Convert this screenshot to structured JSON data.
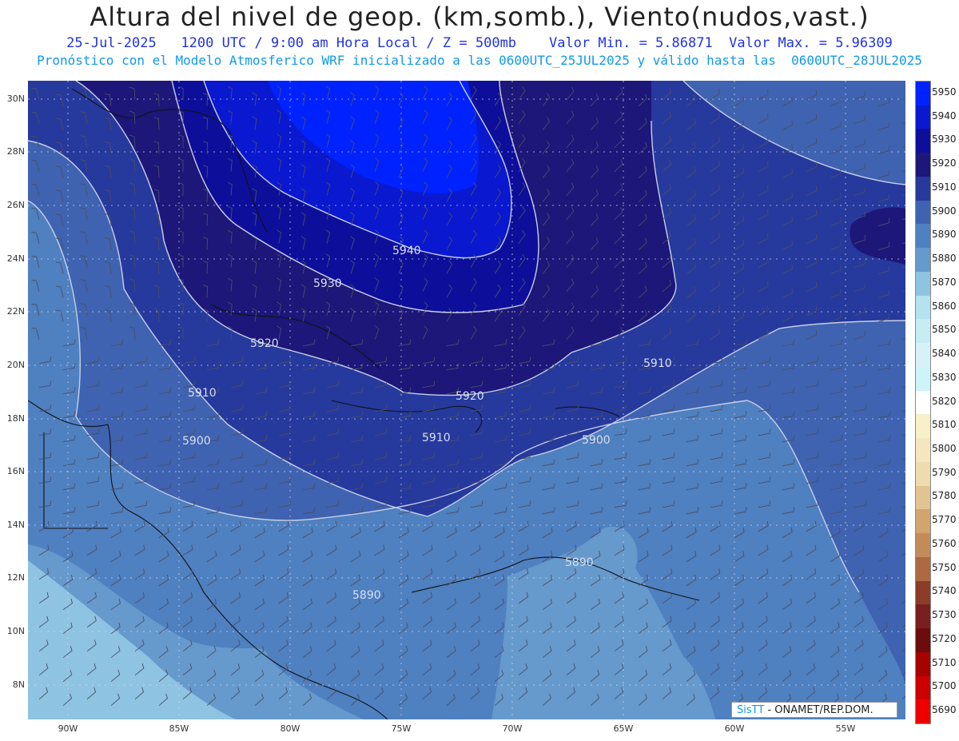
{
  "header": {
    "title": "Altura del nivel de geop. (km,somb.), Viento(nudos,vast.)",
    "line1": "25-Jul-2025   1200 UTC / 9:00 am Hora Local / Z = 500mb    Valor Min. = 5.86871  Valor Max. = 5.96309",
    "line2": "Pronóstico con el Modelo Atmosferico WRF inicializado a las 0600UTC_25JUL2025 y válido hasta las  0600UTC_28JUL2025"
  },
  "axes": {
    "lat_labels": [
      "30N",
      "28N",
      "26N",
      "24N",
      "22N",
      "20N",
      "18N",
      "16N",
      "14N",
      "12N",
      "10N",
      "8N"
    ],
    "lon_labels": [
      "90W",
      "85W",
      "80W",
      "75W",
      "70W",
      "65W",
      "60W",
      "55W"
    ]
  },
  "contour_labels": [
    "5940",
    "5930",
    "5920",
    "5920",
    "5910",
    "5910",
    "5910",
    "5900",
    "5900",
    "5890",
    "5890"
  ],
  "colorbar": {
    "levels": [
      "5950",
      "5940",
      "5930",
      "5920",
      "5910",
      "5900",
      "5890",
      "5880",
      "5870",
      "5860",
      "5850",
      "5840",
      "5830",
      "5820",
      "5810",
      "5800",
      "5790",
      "5780",
      "5770",
      "5760",
      "5750",
      "5740",
      "5730",
      "5720",
      "5710",
      "5700",
      "5690"
    ],
    "colors": [
      "#0022ff",
      "#0a18d0",
      "#0d0f9a",
      "#1c1778",
      "#26399c",
      "#3f63b0",
      "#4f80c0",
      "#6699cc",
      "#8ec3e1",
      "#b4e2ef",
      "#c6edf4",
      "#d6f2f8",
      "#cdf4f8",
      "#ffffff",
      "#f7f0c8",
      "#f5e6bf",
      "#eedcb0",
      "#e2c392",
      "#d2a46e",
      "#c28c59",
      "#ad6942",
      "#8c3d28",
      "#7a1f1f",
      "#6d0c0c",
      "#a60202",
      "#cc0000",
      "#ee0000"
    ]
  },
  "logo": {
    "brand": "SisTT",
    "org": "- ONAMET/REP.DOM."
  }
}
